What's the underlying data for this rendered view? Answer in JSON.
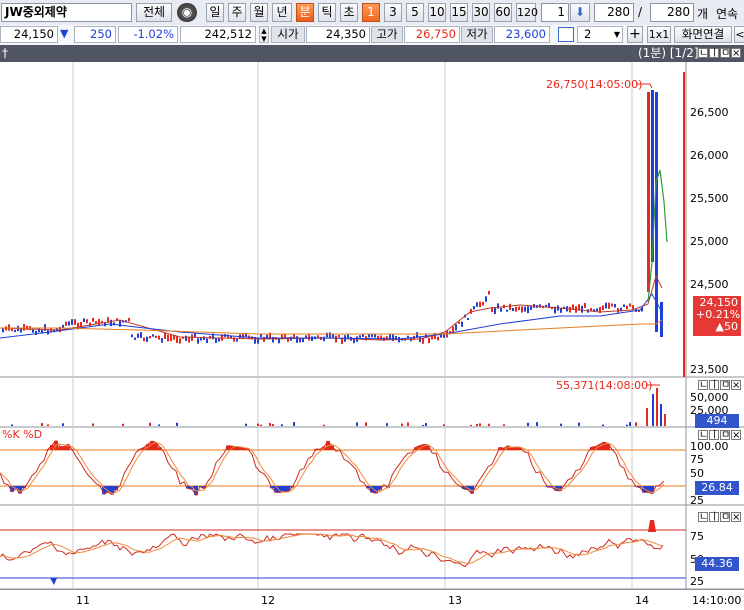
{
  "toolbar": {
    "stock_name": "JW중외제약",
    "all_button": "전체",
    "period_tabs": [
      "일",
      "주",
      "월",
      "년",
      "분",
      "틱",
      "초"
    ],
    "active_period": "분",
    "minute_options": [
      "1",
      "3",
      "5",
      "10",
      "15",
      "30",
      "60",
      "120"
    ],
    "active_minute": "1",
    "count_input": "1",
    "range_start": "280",
    "separator": "/",
    "range_end": "280",
    "unit_label": "개",
    "continuous_label": "연속"
  },
  "pricebar": {
    "current_price": "24,150",
    "change_arrow": "▼",
    "change_value": "250",
    "change_rate": "-1.02%",
    "volume": "242,512",
    "open_label": "시가",
    "open_value": "24,350",
    "high_label": "고가",
    "high_value": "26,750",
    "low_label": "저가",
    "low_value": "23,600",
    "layout_select": "2",
    "plus_label": "+",
    "view_1x1": "1x1",
    "screen_link": "화면연결",
    "arrow_left": "<"
  },
  "chart_header": {
    "left_fragment": "†",
    "right_text": "(1분) [1/2]",
    "buttons": [
      "ㄴ",
      "ㅣ",
      "ㅁ",
      "×"
    ]
  },
  "price_panel": {
    "annotation": "26,750(14:05:00)",
    "y_ticks": [
      "26,500",
      "26,000",
      "25,500",
      "25,000",
      "24,500",
      "23,500"
    ],
    "badge": {
      "price": "24,150",
      "rate": "+0.21%",
      "change": "▲50"
    }
  },
  "volume_panel": {
    "annotation": "55,371(14:08:00)",
    "y_ticks": [
      "50,000",
      "25,000"
    ],
    "badge": "494"
  },
  "stoch_panel": {
    "title": "%K %D",
    "y_ticks": [
      "100.00",
      "75",
      "50",
      "25"
    ],
    "badge": "26.84"
  },
  "rsi_panel": {
    "y_ticks": [
      "75",
      "50",
      "25"
    ],
    "badge": "44.36"
  },
  "x_axis": {
    "ticks": [
      "11",
      "12",
      "13",
      "14"
    ],
    "end_time": "14:10:00"
  },
  "colors": {
    "up": "#e8281c",
    "down": "#1f3fd6",
    "header_bg": "#4f5562",
    "badge_red": "#e53935",
    "badge_blue": "#3355cc",
    "accent_orange": "#f0661e"
  },
  "chart_data": {
    "type": "line",
    "title": "",
    "x": [
      "11",
      "12",
      "13",
      "14"
    ],
    "series": [
      {
        "values": [
          24150,
          24200,
          24250,
          24350,
          26750,
          24150
        ]
      }
    ],
    "ylim": [
      23500,
      26750
    ],
    "annotations": [
      "26,750(14:05:00)",
      "55,371(14:08:00)"
    ]
  }
}
